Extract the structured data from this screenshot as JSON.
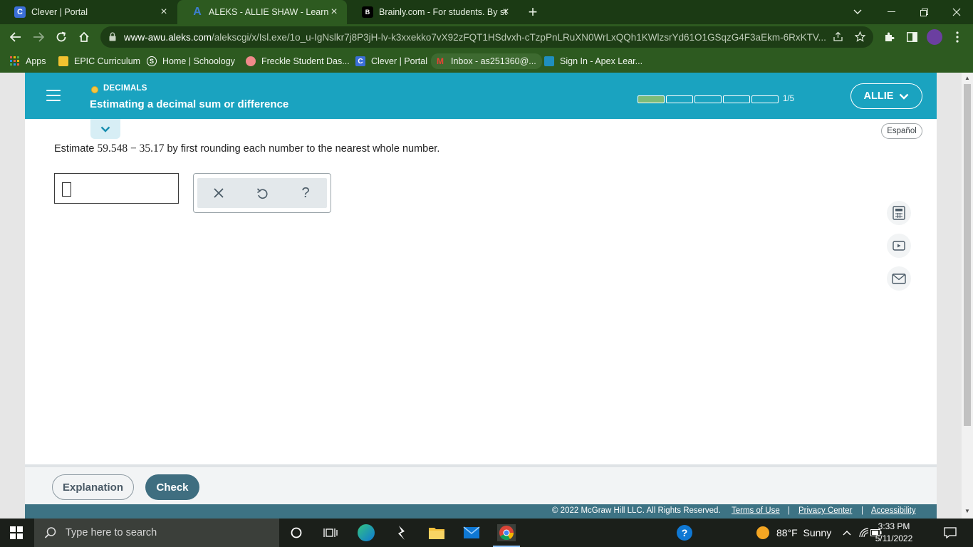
{
  "browser": {
    "tabs": [
      {
        "title": "Clever | Portal",
        "icon": "clever-icon"
      },
      {
        "title": "ALEKS - ALLIE SHAW - Learn",
        "icon": "aleks-icon"
      },
      {
        "title": "Brainly.com - For students. By stu",
        "icon": "brainly-icon"
      }
    ],
    "url_host": "www-awu.aleks.com",
    "url_path": "/alekscgi/x/Isl.exe/1o_u-IgNslkr7j8P3jH-lv-k3xxekko7vX92zFQT1HSdvxh-cTzpPnLRuXN0WrLxQQh1KWlzsrYd61O1GSqzG4F3aEkm-6RxKTV...",
    "bookmarks": [
      {
        "label": "Apps",
        "icon": "apps-grid-icon"
      },
      {
        "label": "EPIC Curriculum",
        "icon": "bookmark-icon"
      },
      {
        "label": "Home | Schoology",
        "icon": "schoology-icon"
      },
      {
        "label": "Freckle Student Das...",
        "icon": "freckle-icon"
      },
      {
        "label": "Clever | Portal",
        "icon": "clever-icon"
      },
      {
        "label": "Inbox - as251360@...",
        "icon": "gmail-icon"
      },
      {
        "label": "Sign In - Apex Lear...",
        "icon": "apex-icon"
      }
    ]
  },
  "aleks": {
    "topic": "DECIMALS",
    "lesson_title": "Estimating a decimal sum or difference",
    "progress": {
      "completed": 1,
      "total": 5,
      "label": "1/5"
    },
    "user_button": "ALLIE",
    "language_button": "Español",
    "question": {
      "prefix": "Estimate",
      "expression": "59.548 − 35.17",
      "suffix": "by first rounding each number to the nearest whole number."
    },
    "answer_value": "",
    "tools": [
      "clear-icon",
      "undo-icon",
      "help-icon"
    ],
    "side_tools": [
      "calculator-icon",
      "video-icon",
      "mail-icon"
    ],
    "buttons": {
      "explanation": "Explanation",
      "check": "Check"
    },
    "footer": {
      "copyright": "© 2022 McGraw Hill LLC. All Rights Reserved.",
      "links": [
        "Terms of Use",
        "Privacy Center",
        "Accessibility"
      ]
    }
  },
  "taskbar": {
    "search_placeholder": "Type here to search",
    "weather": "88°F  Sunny",
    "time": "3:33 PM",
    "date": "5/11/2022"
  },
  "colors": {
    "header": "#1aa3c0",
    "check_button": "#3f6e80",
    "browser_frame": "#2d5a20"
  }
}
